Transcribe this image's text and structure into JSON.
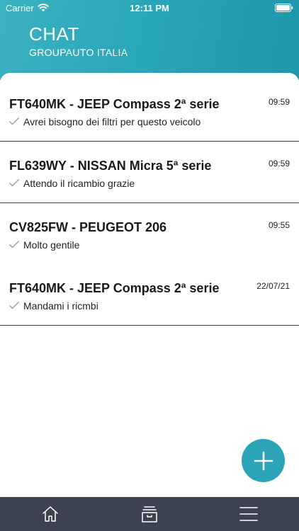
{
  "status_bar": {
    "carrier": "Carrier",
    "time": "12:11 PM"
  },
  "header": {
    "title": "CHAT",
    "subtitle": "GROUPAUTO ITALIA"
  },
  "chats": [
    {
      "title": "FT640MK - JEEP Compass 2ª serie",
      "time": "09:59",
      "message": "Avrei bisogno dei filtri per questo veicolo"
    },
    {
      "title": "FL639WY - NISSAN Micra 5ª serie",
      "time": "09:59",
      "message": "Attendo il ricambio grazie"
    },
    {
      "title": "CV825FW - PEUGEOT 206",
      "time": "09:55",
      "message": "Molto gentile"
    },
    {
      "title": "FT640MK - JEEP Compass 2ª serie",
      "time": "22/07/21",
      "message": "Mandami i ricmbi"
    }
  ],
  "icons": {
    "fab": "plus-icon",
    "nav": [
      "home-icon",
      "archive-box-icon",
      "menu-icon"
    ]
  },
  "colors": {
    "accent": "#2aa4b6",
    "nav_background": "#3d4250"
  }
}
